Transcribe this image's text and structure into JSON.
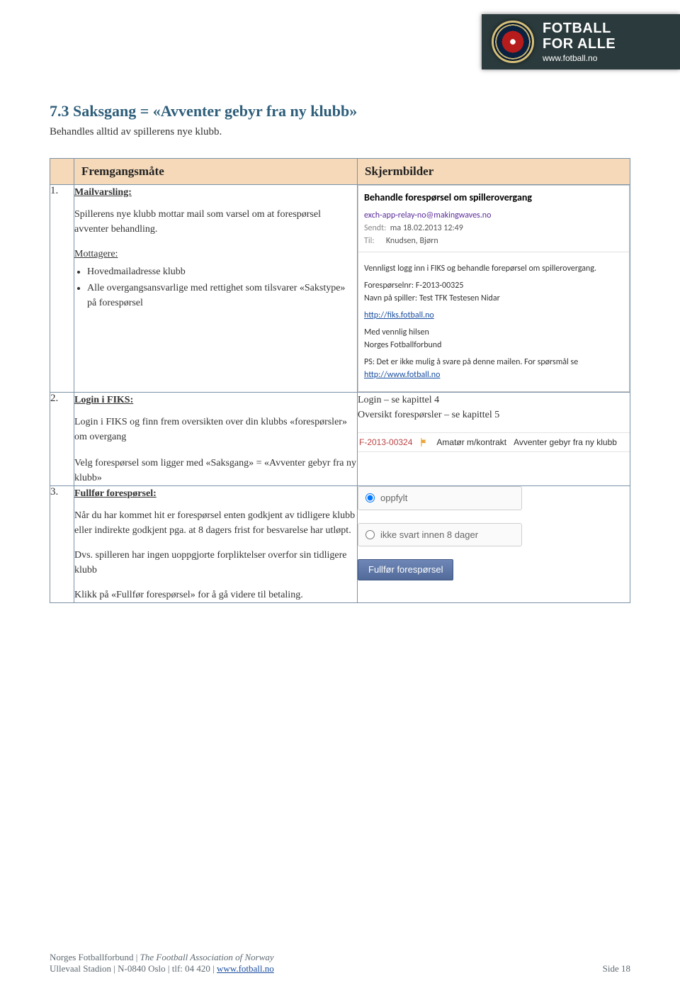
{
  "logo": {
    "line1": "FOTBALL",
    "line2": "FOR ALLE",
    "site": "www.fotball.no"
  },
  "section": {
    "heading": "7.3  Saksgang = «Avventer gebyr fra ny klubb»",
    "intro": "Behandles alltid av spillerens nye klubb."
  },
  "table": {
    "h1": "Fremgangsmåte",
    "h2": "Skjermbilder"
  },
  "step1": {
    "num": "1.",
    "title": "Mailvarsling:",
    "p1": "Spillerens nye klubb mottar mail som varsel om at forespørsel avventer behandling.",
    "recip_label": "Mottagere:",
    "b1": "Hovedmailadresse klubb",
    "b2": "Alle overgangsansvarlige med rettighet som tilsvarer «Sakstype» på forespørsel"
  },
  "email": {
    "title": "Behandle forespørsel om spillerovergang",
    "from": "exch-app-relay-no@makingwaves.no",
    "sent_lbl": "Sendt:",
    "sent_val": "ma 18.02.2013 12:49",
    "to_lbl": "Til:",
    "to_val": "Knudsen, Bjørn",
    "p1": "Vennligst logg inn i FIKS og behandle forepørsel om spillerovergang.",
    "p2": "Forespørselnr: F-2013-00325",
    "p3": "Navn på spiller: Test TFK Testesen Nidar",
    "link": "http://fiks.fotball.no",
    "p4": "Med vennlig hilsen",
    "p5": "Norges Fotballforbund",
    "p6a": "PS: Det er ikke mulig å svare på denne mailen. For spørsmål se ",
    "p6b": "http://www.fotball.no"
  },
  "step2": {
    "num": "2.",
    "title": "Login i FIKS:",
    "p1": "Login i FIKS og finn frem oversikten over din klubbs «forespørsler» om overgang",
    "p2": "Velg forespørsel som ligger med «Saksgang» = «Avventer gebyr fra ny klubb»",
    "right1": "Login – se kapittel 4",
    "right2": "Oversikt forespørsler – se kapittel 5",
    "row_id": "F-2013-00324",
    "row_type": "Amatør m/kontrakt",
    "row_status": "Avventer gebyr fra ny klubb"
  },
  "step3": {
    "num": "3.",
    "title": "Fullfør forespørsel:",
    "p1": "Når du har kommet hit er forespørsel enten godkjent av tidligere klubb eller indirekte godkjent pga. at 8 dagers frist for besvarelse har utløpt.",
    "p2": "Dvs. spilleren har ingen uoppgjorte forpliktelser overfor sin tidligere klubb",
    "p3": "Klikk på «Fullfør forespørsel» for å gå videre til betaling.",
    "opt1": "oppfylt",
    "opt2": "ikke svart innen 8 dager",
    "button": "Fullfør forespørsel"
  },
  "footer": {
    "line1a": "Norges Fotballforbund | ",
    "line1b": "The Football Association of Norway",
    "line2a": "Ullevaal Stadion | N-0840 Oslo | tlf: 04 420 | ",
    "line2b": "www.fotball.no",
    "page": "Side 18"
  }
}
